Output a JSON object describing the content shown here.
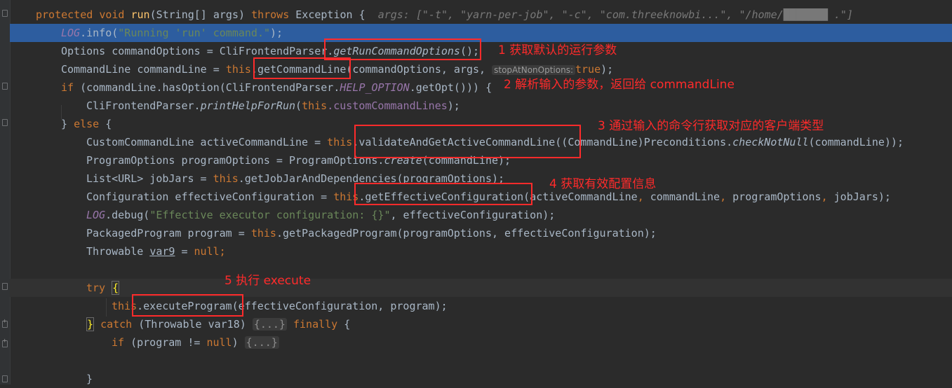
{
  "code": {
    "l1": {
      "kw1": "protected",
      "kw2": "void",
      "name": "run",
      "a": "(String[] args) ",
      "kw3": "throws",
      "b": " Exception {",
      "hint": "args: [\"-t\", \"yarn-per-job\", \"-c\", \"com.threeknowbi...\", \"/home/███████ .\"]"
    },
    "l2": {
      "log": "LOG",
      "a": ".info(",
      "s": "\"Running 'run' command.\"",
      "b": ");"
    },
    "l3": {
      "a": "Options commandOptions = CliFrontendParser.",
      "m": "getRunCommandOptions",
      "b": "();"
    },
    "l4": {
      "a": "CommandLine commandLine = ",
      "kw": "this",
      "b": ".getCommandLine(commandOptions, args, ",
      "hint": "stopAtNonOptions:",
      "v": "true",
      "c": ");"
    },
    "l5": {
      "kw": "if",
      "a": " (commandLine.hasOption(CliFrontendParser.",
      "c": "HELP_OPTION",
      "b": ".getOpt())) {"
    },
    "l6": {
      "a": "CliFrontendParser.",
      "m": "printHelpForRun",
      "b": "(",
      "kw": "this",
      "f": ".customCommandLines",
      "c": ");"
    },
    "l7": {
      "a": "} ",
      "kw": "else",
      "b": " {"
    },
    "l8": {
      "a": "CustomCommandLine activeCommandLine = ",
      "kw": "this",
      "b": ".validateAndGetActiveCommandLine((CommandLine)Preconditions.",
      "m": "checkNotNull",
      "c": "(commandLine));"
    },
    "l9": {
      "a": "ProgramOptions programOptions = ProgramOptions.",
      "m": "create",
      "b": "(commandLine);"
    },
    "l10": {
      "a": "List<URL> jobJars = ",
      "kw": "this",
      "b": ".getJobJarAndDependencies(programOptions);"
    },
    "l11": {
      "a": "Configuration effectiveConfiguration = ",
      "kw": "this",
      "b": ".getEffectiveConfiguration(activeCommandLine",
      ", ": ", ",
      "c": "commandLine",
      ", 2": ", ",
      "d": "programOptions",
      ", 3": ", ",
      "e": "jobJars);"
    },
    "l12": {
      "log": "LOG",
      "a": ".debug(",
      "s": "\"Effective executor configuration: {}\"",
      "b": ", effectiveConfiguration);"
    },
    "l13": {
      "a": "PackagedProgram program = ",
      "kw": "this",
      "b": ".getPackagedProgram(programOptions, effectiveConfiguration);"
    },
    "l14": {
      "a": "Throwable ",
      "v": "var9",
      "b": " = ",
      "kw": "null",
      "c": ";"
    },
    "l16": {
      "kw": "try",
      "b": " ",
      "brace": "{"
    },
    "l17": {
      "kw": "this",
      "a": ".executeProgram(effectiveConfiguration, program);"
    },
    "l18": {
      "brace": "}",
      "b": " ",
      "kw": "catch",
      "a": " (Throwable var18) ",
      "ph": "{...}",
      "c": " ",
      "kw2": "finally",
      "d": " {"
    },
    "l19": {
      "kw": "if",
      "a": " (program != ",
      "kw2": "null",
      "b": ") ",
      "ph": "{...}"
    },
    "l21": {
      "a": "}"
    }
  },
  "annotations": {
    "a1": "1 获取默认的运行参数",
    "a2": "2 解析输入的参数，返回给 commandLine",
    "a3": "3 通过输入的命令行获取对应的客户端类型",
    "a4": "4 获取有效配置信息",
    "a5": "5 执行 execute"
  },
  "colors": {
    "keyword": "#cc7832",
    "method": "#ffc66d",
    "string": "#6a8759",
    "static": "#9876aa",
    "annotation": "#ff2b2b",
    "selection": "#2d5d9f"
  }
}
